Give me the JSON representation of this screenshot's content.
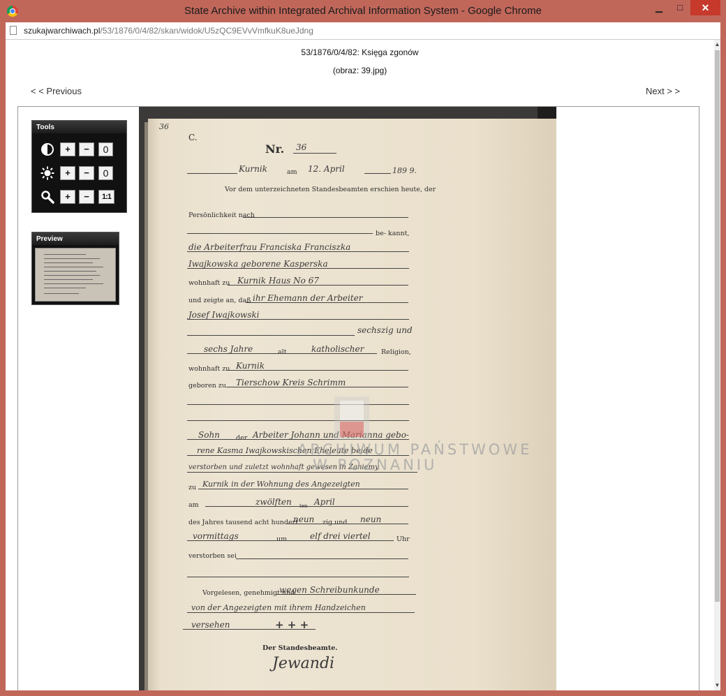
{
  "window": {
    "title": "State Archive within Integrated Archival Information System - Google Chrome",
    "controls": {
      "minimize": "▁",
      "maximize": "□",
      "close": "✕"
    }
  },
  "address": {
    "host": "szukajwarchiwach.pl",
    "path": "/53/1876/0/4/82/skan/widok/U5zQC9EVvVmfkuK8ueJdng"
  },
  "page": {
    "signature": "53/1876/0/4/82: Księga zgonów",
    "image_label": "(obraz: 39.jpg)",
    "prev_label": "< < Previous",
    "next_label": "Next > >"
  },
  "tools": {
    "title": "Tools",
    "rows": [
      {
        "icon": "contrast-icon",
        "plus": "+",
        "minus": "−",
        "value": "0"
      },
      {
        "icon": "brightness-icon",
        "plus": "+",
        "minus": "−",
        "value": "0"
      },
      {
        "icon": "zoom-icon",
        "plus": "+",
        "minus": "−",
        "value": "1:1"
      }
    ]
  },
  "preview": {
    "title": "Preview"
  },
  "document": {
    "page_number": "36",
    "letter": "C.",
    "nr_label": "Nr.",
    "nr_value": "36",
    "place": "Kurnik",
    "am": "am",
    "date": "12. April",
    "year": "189 9.",
    "line_vor": "Vor dem unterzeichneten Standesbeamten erschien heute, der",
    "line_persoenlichkeit": "Persönlichkeit nach",
    "line_bekannt": "be- kannt,",
    "hw_1": "die Arbeiterfrau Franciska Franciszka",
    "hw_2": "Iwajkowska geborene Kasperska",
    "wohnhaft_zu": "wohnhaft zu",
    "hw_3": "Kurnik Haus No 67",
    "line_zeigte": "und zeigte an, daß",
    "hw_4": "ihr Ehemann der Arbeiter",
    "hw_5": "Josef Iwajkowski",
    "hw_6": "sechszig und",
    "hw_7": "sechs Jahre",
    "alt": "alt",
    "hw_8": "katholischer",
    "religion": "Religion,",
    "wohnhaft_zu_2": "wohnhaft zu",
    "hw_9": "Kurnik",
    "geboren_zu": "geboren zu",
    "hw_10": "Tierschow Kreis Schrimm",
    "hw_11": "Sohn",
    "der": "der",
    "hw_12": "Arbeiter Johann und Marianna gebo-",
    "hw_13": "rene Kasma Iwajkowskischen Eheleute beide",
    "hw_14": "verstorben und zuletzt wohnhaft gewesen in Zaniemy",
    "zu": "zu",
    "hw_15": "Kurnik in der Wohnung des Angezeigten",
    "am_2": "am",
    "hw_16": "zwölften",
    "ten": "ten",
    "hw_17": "April",
    "des_jahres": "des Jahres tausend acht hundert",
    "hw_18": "neun",
    "zig_und": "zig und",
    "hw_19": "neun",
    "hw_20": "vormittags",
    "um": "um",
    "hw_21": "elf drei viertel",
    "uhr": "Uhr",
    "verstorben_sei": "verstorben sei",
    "vorgelesen": "Vorgelesen, genehmigt und",
    "hw_22": "wegen Schreibunkunde",
    "hw_23": "von der Angezeigten mit ihrem Handzeichen",
    "hw_24": "versehen",
    "hw_25": "+ + +",
    "standesbeamte": "Der Standesbeamte.",
    "hw_signature": "Jewandi",
    "watermark_1": "ARCHIWUM PAŃSTWOWE",
    "watermark_2": "W POZNANIU"
  }
}
